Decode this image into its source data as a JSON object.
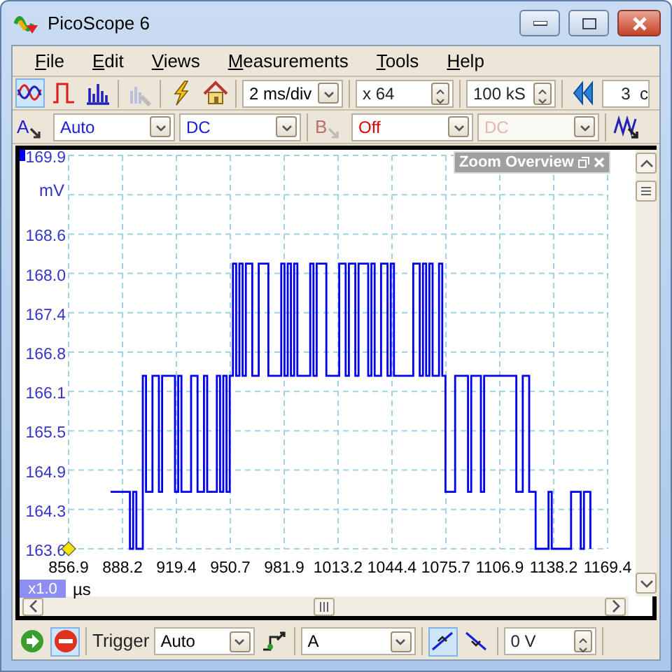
{
  "window": {
    "title": "PicoScope 6"
  },
  "menu": [
    {
      "label": "File"
    },
    {
      "label": "Edit"
    },
    {
      "label": "Views"
    },
    {
      "label": "Measurements"
    },
    {
      "label": "Tools"
    },
    {
      "label": "Help"
    }
  ],
  "toolbar": {
    "modes": [
      {
        "kind": "scope",
        "selected": true
      },
      {
        "kind": "persistence",
        "selected": false
      },
      {
        "kind": "spectrum",
        "selected": false
      }
    ],
    "timebase": "2 ms/div",
    "zoom": "x 64",
    "samples": "100 kS",
    "buffer": "3  c"
  },
  "channels": [
    {
      "name": "A",
      "range": "Auto",
      "coupling": "DC",
      "enabled": true
    },
    {
      "name": "B",
      "range": "Off",
      "coupling": "DC",
      "enabled": false
    }
  ],
  "scope": {
    "y_unit": "mV",
    "y_ticks": [
      "169.9",
      "168.6",
      "168.0",
      "167.4",
      "166.8",
      "166.1",
      "165.5",
      "164.9",
      "164.3",
      "163.6"
    ],
    "x_ticks": [
      "856.9",
      "888.2",
      "919.4",
      "950.7",
      "981.9",
      "1013.2",
      "1044.4",
      "1075.7",
      "1106.9",
      "1138.2",
      "1169.4"
    ],
    "x_unit": "µs",
    "zoom_factor": "x1.0",
    "zoom_overview": "Zoom Overview"
  },
  "trigger_bar": {
    "run_buttons": [
      {
        "kind": "start",
        "selected": false
      },
      {
        "kind": "stop",
        "selected": true
      }
    ],
    "label": "Trigger",
    "mode": "Auto",
    "source": "A",
    "edges": [
      {
        "kind": "rising",
        "selected": true
      },
      {
        "kind": "falling",
        "selected": false
      }
    ],
    "threshold": "0 V"
  }
}
